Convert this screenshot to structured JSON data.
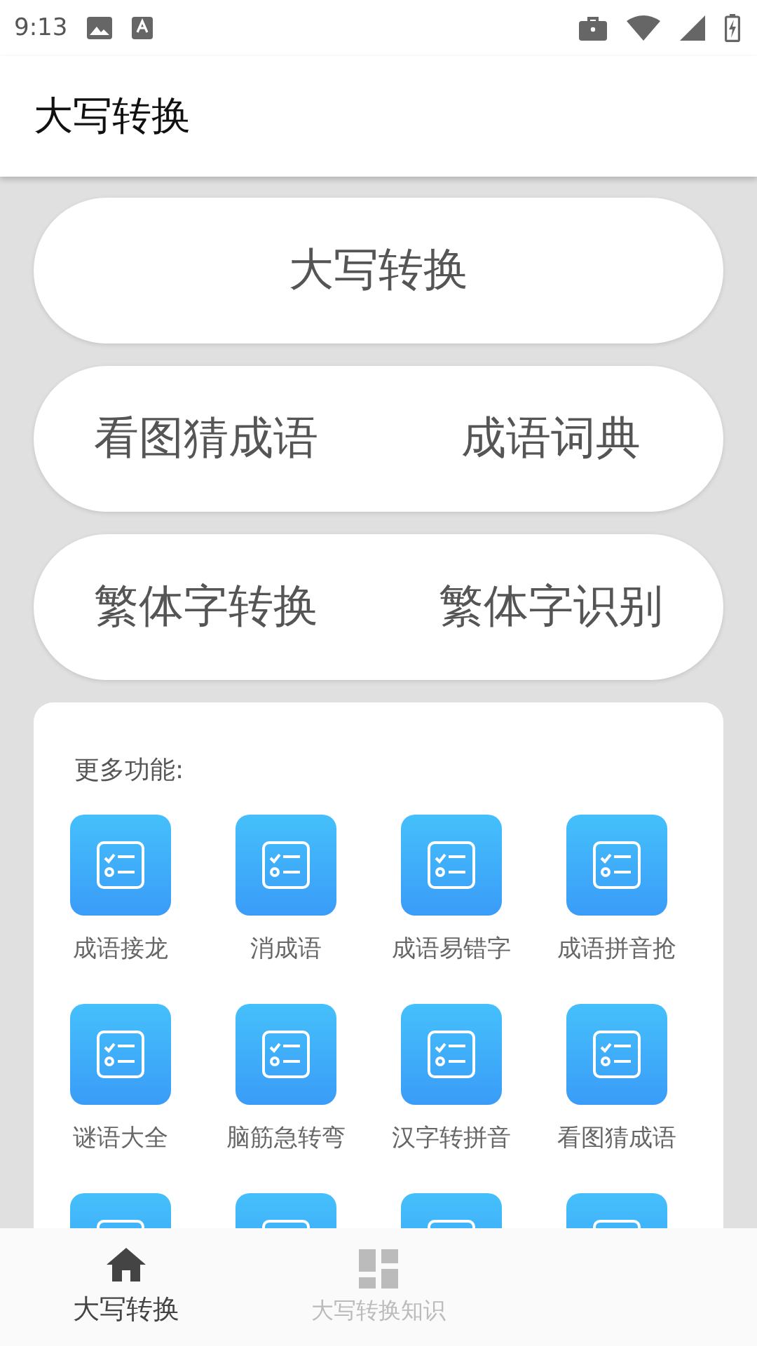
{
  "status_bar": {
    "time": "9:13"
  },
  "app_bar": {
    "title": "大写转换"
  },
  "pill_rows": [
    {
      "buttons": [
        "大写转换"
      ]
    },
    {
      "buttons": [
        "看图猜成语",
        "成语词典"
      ]
    },
    {
      "buttons": [
        "繁体字转换",
        "繁体字识别"
      ]
    }
  ],
  "more": {
    "title": "更多功能:",
    "items": [
      {
        "kind": "labeled",
        "label": "成语接龙"
      },
      {
        "kind": "labeled",
        "label": "消成语"
      },
      {
        "kind": "labeled",
        "label": "成语易错字"
      },
      {
        "kind": "labeled",
        "label": "成语拼音抢"
      },
      {
        "kind": "labeled",
        "label": "谜语大全"
      },
      {
        "kind": "labeled",
        "label": "脑筋急转弯"
      },
      {
        "kind": "labeled",
        "label": "汉字转拼音"
      },
      {
        "kind": "labeled",
        "label": "看图猜成语"
      },
      {
        "kind": "cut"
      },
      {
        "kind": "cut"
      },
      {
        "kind": "cut"
      },
      {
        "kind": "cut"
      }
    ]
  },
  "bottom_nav": [
    {
      "label": "大写转换",
      "selected": true
    },
    {
      "label": "大写转换知识",
      "selected": false
    }
  ]
}
